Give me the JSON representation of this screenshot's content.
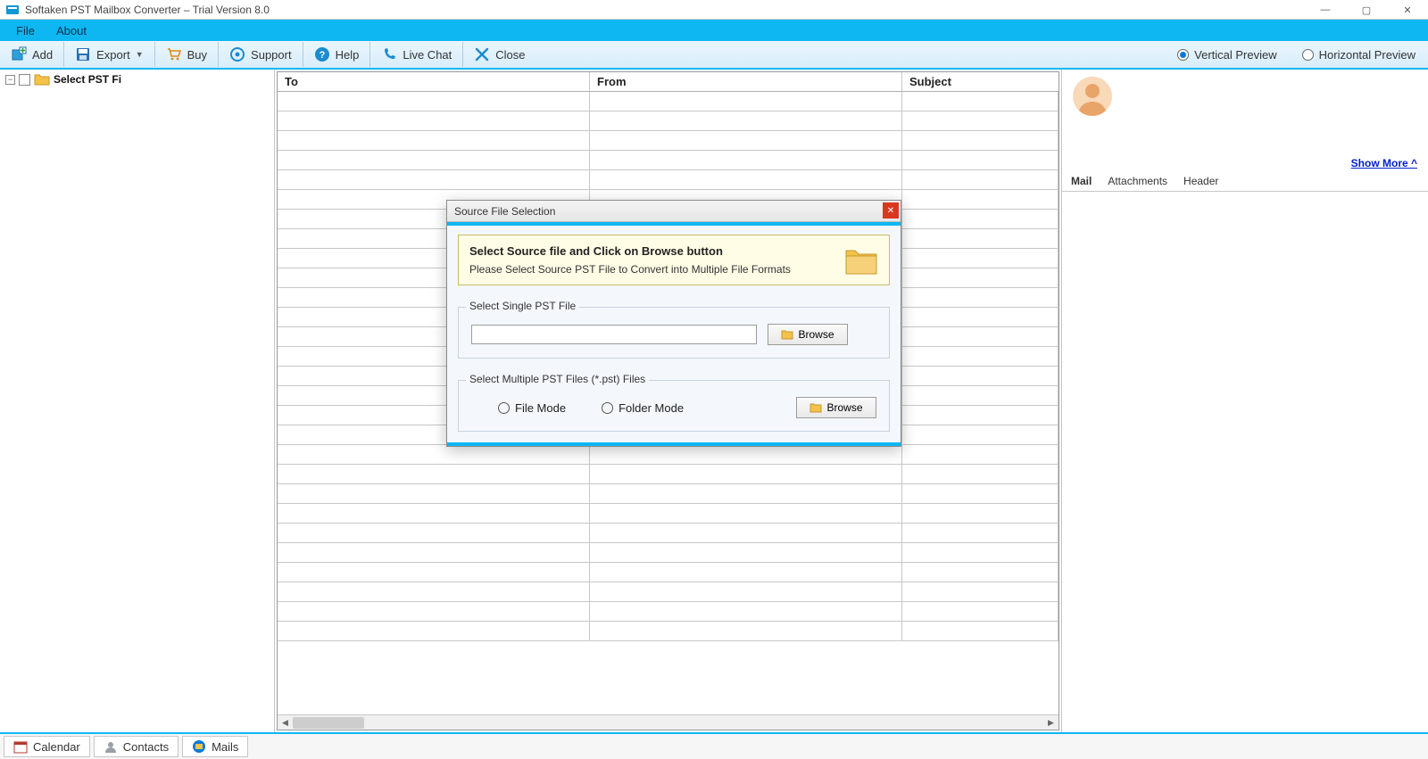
{
  "window": {
    "title": "Softaken PST Mailbox Converter – Trial Version 8.0",
    "controls": {
      "min": "—",
      "max": "▢",
      "close": "✕"
    }
  },
  "menu": {
    "file": "File",
    "about": "About"
  },
  "toolbar": {
    "add": "Add",
    "export": "Export",
    "buy": "Buy",
    "support": "Support",
    "help": "Help",
    "livechat": "Live Chat",
    "close": "Close"
  },
  "preview_mode": {
    "vertical": "Vertical Preview",
    "horizontal": "Horizontal Preview",
    "selected": "vertical"
  },
  "tree": {
    "root_label": "Select PST Fi"
  },
  "grid": {
    "columns": {
      "to": "To",
      "from": "From",
      "subject": "Subject"
    }
  },
  "preview": {
    "show_more": "Show More ^",
    "tabs": {
      "mail": "Mail",
      "attachments": "Attachments",
      "header": "Header"
    }
  },
  "bottom": {
    "calendar": "Calendar",
    "contacts": "Contacts",
    "mails": "Mails"
  },
  "dialog": {
    "title": "Source File Selection",
    "info_header": "Select Source file and Click on Browse button",
    "info_sub": "Please Select Source PST File to Convert into Multiple File Formats",
    "group1_label": "Select Single PST File",
    "browse": "Browse",
    "group2_label": "Select Multiple PST Files (*.pst) Files",
    "file_mode": "File Mode",
    "folder_mode": "Folder Mode"
  }
}
